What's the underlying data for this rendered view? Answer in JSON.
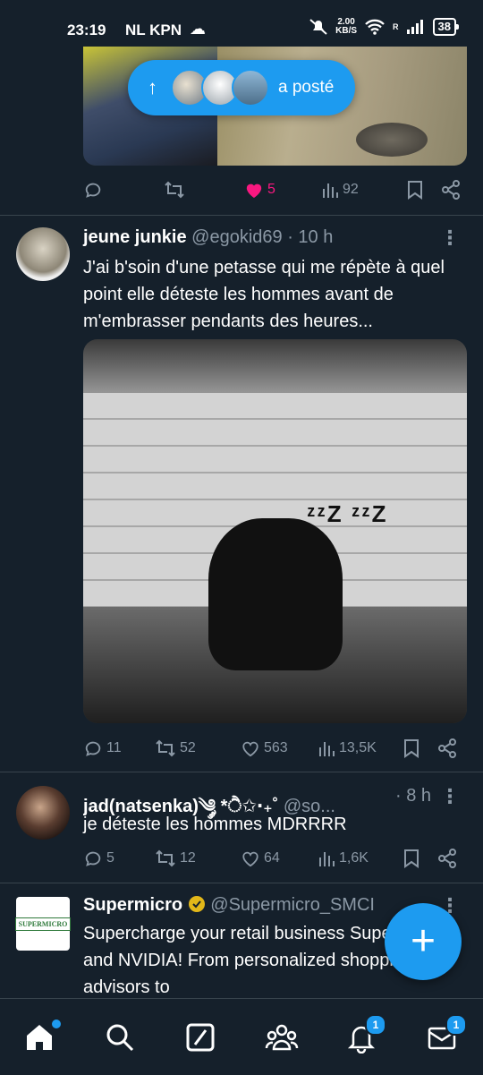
{
  "status_bar": {
    "time": "23:19",
    "carrier": "NL KPN",
    "net_speed_value": "2.00",
    "net_speed_unit": "KB/S",
    "signal_label": "R",
    "battery": "38"
  },
  "top_tweet": {
    "actions": {
      "replies": "",
      "retweets": "",
      "likes": "5",
      "views": "92"
    }
  },
  "posted_pill": {
    "label": "a posté"
  },
  "tweets": [
    {
      "name": "jeune junkie",
      "handle": "@egokid69",
      "time": "· 10 h",
      "text": "J'ai b'soin d'une petasse qui me répète à quel point elle déteste les hommes avant de m'embrasser pendants des heures...",
      "actions": {
        "replies": "11",
        "retweets": "52",
        "likes": "563",
        "views": "13,5K"
      }
    },
    {
      "name": "jad(natsenka)༄༘ *ੈ✩‧₊˚",
      "handle": "@so...",
      "time": "· 8 h",
      "text": "je déteste les hommes MDRRRR",
      "actions": {
        "replies": "5",
        "retweets": "12",
        "likes": "64",
        "views": "1,6K"
      }
    },
    {
      "name": "Supermicro",
      "handle": "@Supermicro_SMCI",
      "text": "Supercharge your retail business Supermicro and NVIDIA! From personalized shopping advisors to",
      "logo_text": "SUPERMICRO"
    }
  ],
  "nav": {
    "notifications_badge": "1",
    "messages_badge": "1"
  },
  "colors": {
    "accent": "#1d9bf0",
    "like": "#f91880",
    "background": "#15202b",
    "muted": "#8b98a5",
    "verified": "#e2b719"
  }
}
